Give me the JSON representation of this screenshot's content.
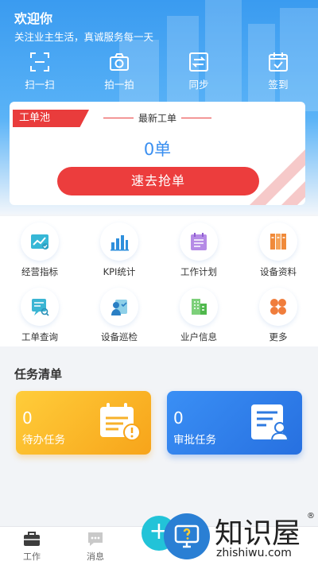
{
  "header": {
    "welcome": "欢迎你",
    "slogan": "关注业主生活，真诚服务每一天",
    "quick_actions": [
      {
        "label": "扫一扫",
        "icon": "scan-icon"
      },
      {
        "label": "拍一拍",
        "icon": "camera-icon"
      },
      {
        "label": "同步",
        "icon": "sync-icon"
      },
      {
        "label": "签到",
        "icon": "checkin-icon"
      }
    ]
  },
  "order_card": {
    "tag": "工单池",
    "latest_title": "最新工单",
    "count": "0单",
    "grab_button": "速去抢单"
  },
  "grid": [
    {
      "label": "经营指标",
      "icon": "business-chart-icon"
    },
    {
      "label": "KPI统计",
      "icon": "bar-chart-icon"
    },
    {
      "label": "工作计划",
      "icon": "plan-icon"
    },
    {
      "label": "设备资料",
      "icon": "binders-icon"
    },
    {
      "label": "工单查询",
      "icon": "order-search-icon"
    },
    {
      "label": "设备巡检",
      "icon": "inspection-icon"
    },
    {
      "label": "业户信息",
      "icon": "building-icon"
    },
    {
      "label": "更多",
      "icon": "more-icon"
    }
  ],
  "tasks": {
    "title": "任务清单",
    "pending": {
      "count": "0",
      "label": "待办任务"
    },
    "approve": {
      "count": "0",
      "label": "审批任务"
    }
  },
  "bottom_nav": {
    "work": "工作",
    "messages": "消息",
    "plus": "+"
  },
  "watermark": {
    "name": "知识屋",
    "reg": "®",
    "url": "zhishiwu.com"
  },
  "colors": {
    "primary_blue": "#3a9bf0",
    "accent_red": "#ec3d3d",
    "pending_yellow": "#f7a41a",
    "approve_blue": "#2770e0",
    "plus_cyan": "#22c3d8"
  }
}
